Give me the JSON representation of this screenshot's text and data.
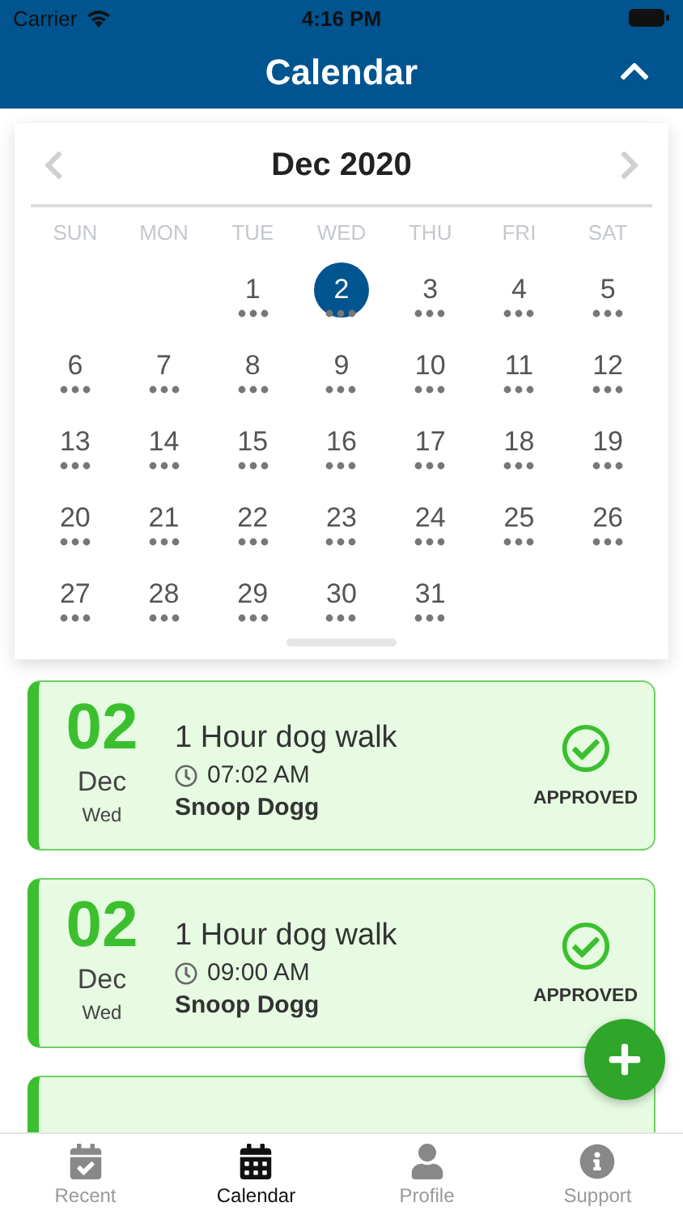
{
  "status_bar": {
    "carrier": "Carrier",
    "time": "4:16 PM"
  },
  "header": {
    "title": "Calendar"
  },
  "calendar": {
    "month": "Dec 2020",
    "weekdays": [
      "SUN",
      "MON",
      "TUE",
      "WED",
      "THU",
      "FRI",
      "SAT"
    ],
    "cells": [
      {
        "kind": "blank"
      },
      {
        "kind": "blank"
      },
      {
        "kind": "day",
        "label": "1",
        "selected": false,
        "events": true
      },
      {
        "kind": "day",
        "label": "2",
        "selected": true,
        "events": true
      },
      {
        "kind": "day",
        "label": "3",
        "selected": false,
        "events": true
      },
      {
        "kind": "day",
        "label": "4",
        "selected": false,
        "events": true
      },
      {
        "kind": "day",
        "label": "5",
        "selected": false,
        "events": true
      },
      {
        "kind": "day",
        "label": "6",
        "selected": false,
        "events": true
      },
      {
        "kind": "day",
        "label": "7",
        "selected": false,
        "events": true
      },
      {
        "kind": "day",
        "label": "8",
        "selected": false,
        "events": true
      },
      {
        "kind": "day",
        "label": "9",
        "selected": false,
        "events": true
      },
      {
        "kind": "day",
        "label": "10",
        "selected": false,
        "events": true
      },
      {
        "kind": "day",
        "label": "11",
        "selected": false,
        "events": true
      },
      {
        "kind": "day",
        "label": "12",
        "selected": false,
        "events": true
      },
      {
        "kind": "day",
        "label": "13",
        "selected": false,
        "events": true
      },
      {
        "kind": "day",
        "label": "14",
        "selected": false,
        "events": true
      },
      {
        "kind": "day",
        "label": "15",
        "selected": false,
        "events": true
      },
      {
        "kind": "day",
        "label": "16",
        "selected": false,
        "events": true
      },
      {
        "kind": "day",
        "label": "17",
        "selected": false,
        "events": true
      },
      {
        "kind": "day",
        "label": "18",
        "selected": false,
        "events": true
      },
      {
        "kind": "day",
        "label": "19",
        "selected": false,
        "events": true
      },
      {
        "kind": "day",
        "label": "20",
        "selected": false,
        "events": true
      },
      {
        "kind": "day",
        "label": "21",
        "selected": false,
        "events": true
      },
      {
        "kind": "day",
        "label": "22",
        "selected": false,
        "events": true
      },
      {
        "kind": "day",
        "label": "23",
        "selected": false,
        "events": true
      },
      {
        "kind": "day",
        "label": "24",
        "selected": false,
        "events": true
      },
      {
        "kind": "day",
        "label": "25",
        "selected": false,
        "events": true
      },
      {
        "kind": "day",
        "label": "26",
        "selected": false,
        "events": true
      },
      {
        "kind": "day",
        "label": "27",
        "selected": false,
        "events": true
      },
      {
        "kind": "day",
        "label": "28",
        "selected": false,
        "events": true
      },
      {
        "kind": "day",
        "label": "29",
        "selected": false,
        "events": true
      },
      {
        "kind": "day",
        "label": "30",
        "selected": false,
        "events": true
      },
      {
        "kind": "day",
        "label": "31",
        "selected": false,
        "events": true
      }
    ]
  },
  "appointments": [
    {
      "day": "02",
      "month": "Dec",
      "weekday": "Wed",
      "title": "1 Hour dog walk",
      "time": "07:02 AM",
      "client": "Snoop Dogg",
      "status": "APPROVED"
    },
    {
      "day": "02",
      "month": "Dec",
      "weekday": "Wed",
      "title": "1 Hour dog walk",
      "time": "09:00 AM",
      "client": "Snoop Dogg",
      "status": "APPROVED"
    }
  ],
  "tab_bar": [
    {
      "kind": "recent",
      "label": "Recent",
      "selected": false
    },
    {
      "kind": "calendar",
      "label": "Calendar",
      "selected": true
    },
    {
      "kind": "profile",
      "label": "Profile",
      "selected": false
    },
    {
      "kind": "support",
      "label": "Support",
      "selected": false
    }
  ]
}
